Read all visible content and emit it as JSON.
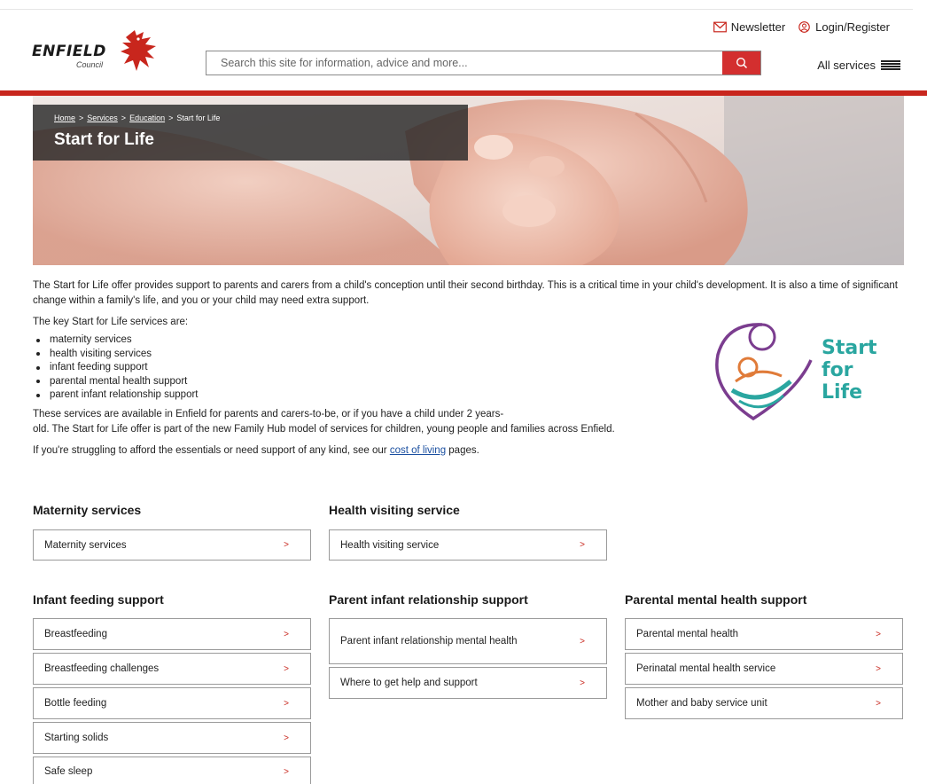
{
  "header": {
    "logo_text": "ENFIELD",
    "logo_sub": "Council",
    "newsletter": "Newsletter",
    "login": "Login/Register",
    "search_placeholder": "Search this site for information, advice and more...",
    "all_services": "All services"
  },
  "breadcrumb": {
    "home": "Home",
    "services": "Services",
    "education": "Education",
    "current": "Start for Life",
    "sep": ">"
  },
  "page_title": "Start for Life",
  "content": {
    "intro": "The Start for Life offer provides support to parents and carers from a child's conception until their second birthday. This is a critical time in your child's development. It is also a time of significant change within a family's life, and you or your child may need extra support.",
    "key_heading": "The key Start for Life services are:",
    "key_items": [
      "maternity services",
      "health visiting services",
      "infant feeding support",
      "parental mental health support",
      "parent infant relationship support"
    ],
    "available_1": "These services are available in Enfield for parents and carers-to-be, or if you have a child under 2 years-",
    "available_2": "old. The Start for Life offer is part of the new Family Hub model of services for children, young people and families across Enfield.",
    "struggling_pre": "If you're struggling to afford the essentials or need support of any kind, see our ",
    "struggling_link": "cost of living",
    "struggling_post": " pages.",
    "sfl_logo_lines": [
      "Start",
      "for",
      "Life"
    ]
  },
  "groups": {
    "maternity": {
      "title": "Maternity services",
      "items": [
        "Maternity services"
      ]
    },
    "health_visiting": {
      "title": "Health visiting service",
      "items": [
        "Health visiting service"
      ]
    },
    "infant_feeding": {
      "title": "Infant feeding support",
      "items": [
        "Breastfeeding",
        "Breastfeeding challenges",
        "Bottle feeding",
        "Starting solids",
        "Safe sleep"
      ]
    },
    "relationship": {
      "title": "Parent infant relationship support",
      "items": [
        "Parent infant relationship mental health",
        "Where to get help and support"
      ]
    },
    "mental_health": {
      "title": "Parental mental health support",
      "items": [
        "Parental mental health",
        "Perinatal mental health service",
        "Mother and baby service unit"
      ]
    }
  },
  "arrow": ">",
  "colors": {
    "brand_red": "#c8261d",
    "search_button": "#d32f2f",
    "sfl_teal": "#2aa6a0",
    "sfl_purple": "#7b3d8f"
  }
}
